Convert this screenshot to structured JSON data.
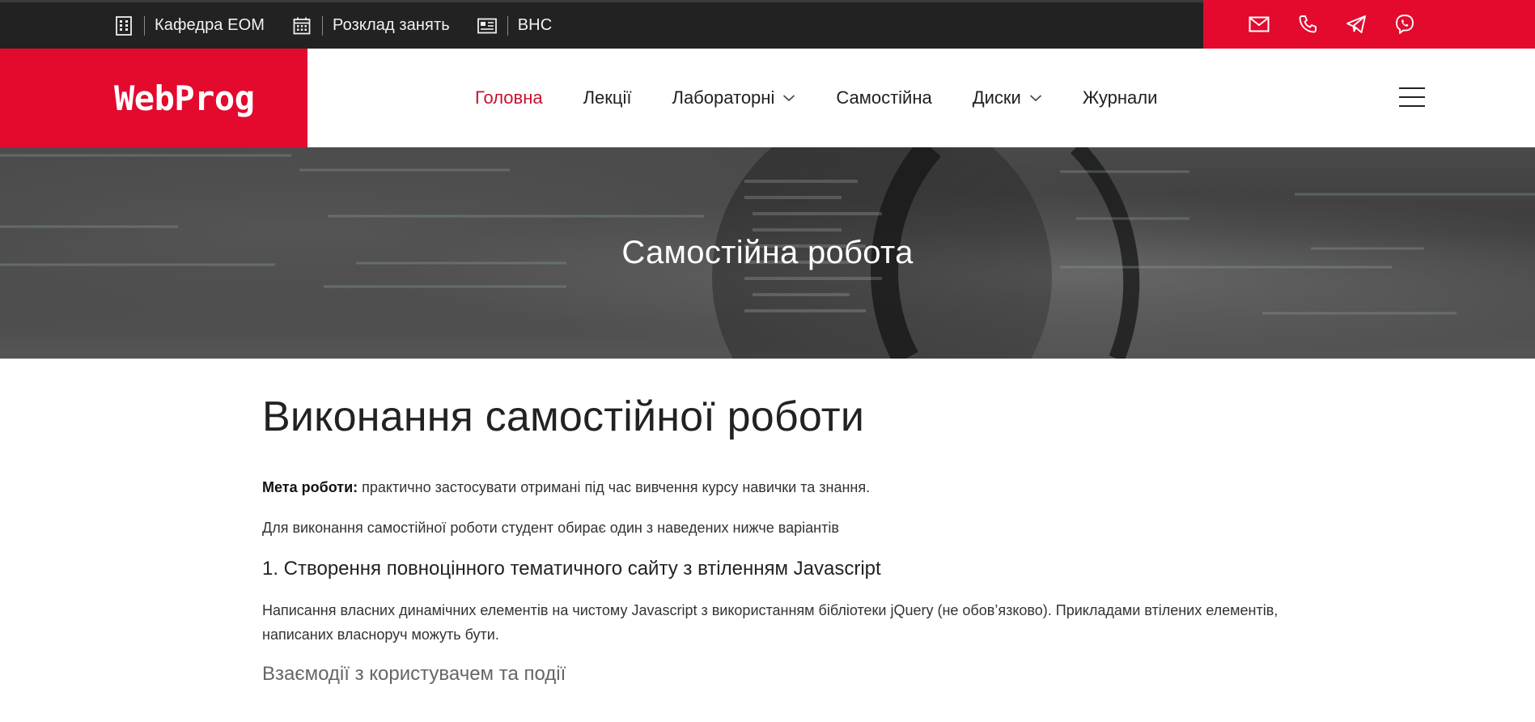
{
  "topbar": {
    "links": [
      {
        "icon": "building-icon",
        "label": "Кафедра ЕОМ"
      },
      {
        "icon": "calendar-icon",
        "label": "Розклад занять"
      },
      {
        "icon": "id-card-icon",
        "label": "ВНС"
      }
    ],
    "contacts": [
      "mail-icon",
      "phone-icon",
      "telegram-icon",
      "viber-icon"
    ]
  },
  "header": {
    "logo": "WebProg",
    "nav": [
      {
        "label": "Головна",
        "active": true,
        "dropdown": false
      },
      {
        "label": "Лекції",
        "active": false,
        "dropdown": false
      },
      {
        "label": "Лабораторні",
        "active": false,
        "dropdown": true
      },
      {
        "label": "Самостійна",
        "active": false,
        "dropdown": false
      },
      {
        "label": "Диски",
        "active": false,
        "dropdown": true
      },
      {
        "label": "Журнали",
        "active": false,
        "dropdown": false
      }
    ]
  },
  "hero": {
    "title": "Самостійна робота"
  },
  "content": {
    "heading": "Виконання самостійної роботи",
    "goal_label": "Мета роботи:",
    "goal_text": " практично застосувати отримані під час вивчення курсу навички та знання.",
    "intro": "Для виконання самостійної роботи студент обирає один з наведених нижче варіантів",
    "section1_title": "1. Створення повноцінного тематичного сайту з втіленням Javascript",
    "section1_desc": "Написання власних динамічних елементів на чистому Javascript з використанням бібліотеки jQuery (не обов’язково). Прикладами втілених елементів, написаних власноруч можуть бути.",
    "subsection_title": "Взаємодії з користувачем та події"
  },
  "colors": {
    "brand_red": "#e30a2e",
    "active_nav": "#c8102e",
    "topbar_bg": "#222222"
  }
}
